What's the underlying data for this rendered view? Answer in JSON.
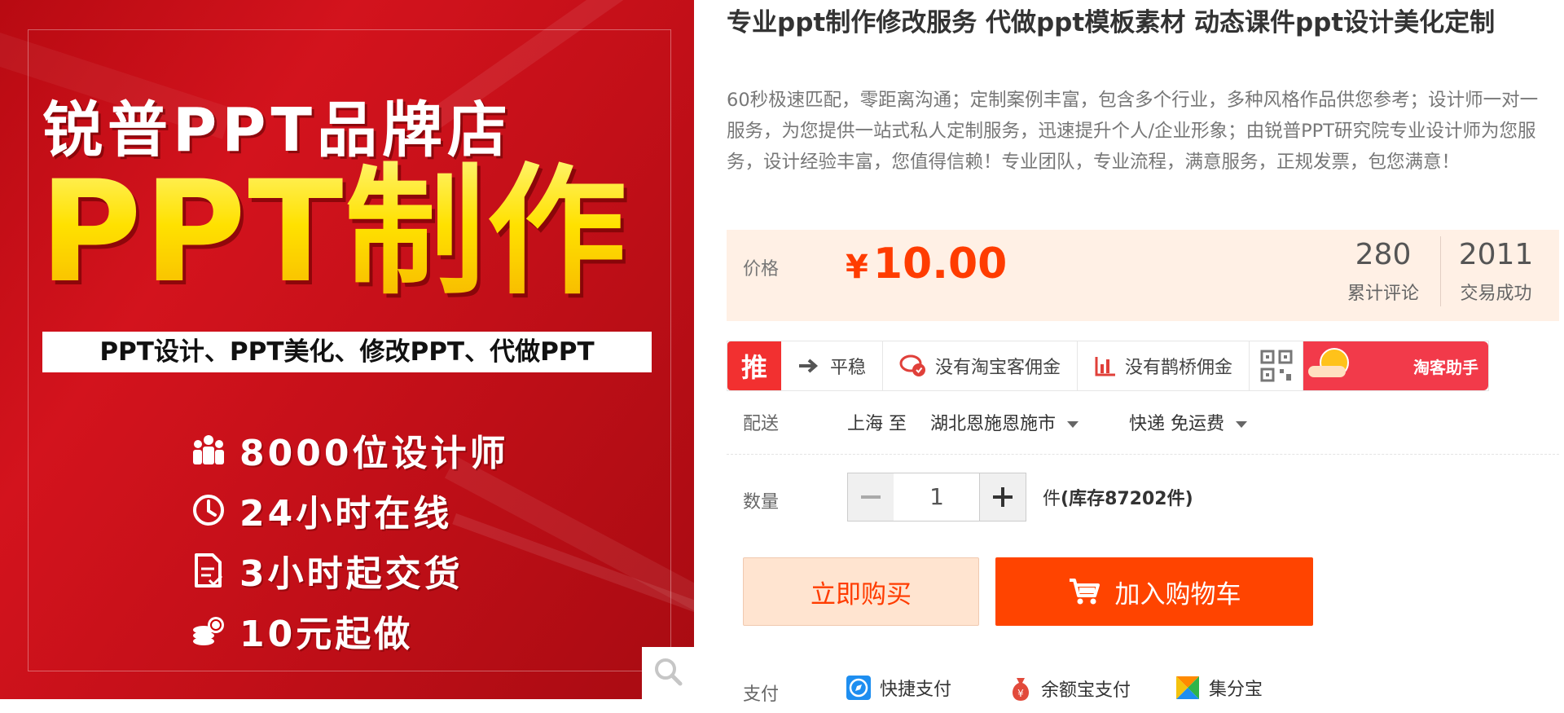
{
  "image": {
    "brand_title": "锐普PPT品牌店",
    "headline": "PPT制作",
    "services": "PPT设计、PPT美化、修改PPT、代做PPT",
    "features": [
      {
        "icon": "people-icon",
        "text": "8000位设计师"
      },
      {
        "icon": "clock-icon",
        "text": "24小时在线"
      },
      {
        "icon": "document-icon",
        "text": "3小时起交货"
      },
      {
        "icon": "coins-icon",
        "text": "10元起做"
      }
    ],
    "zoom_icon": "magnifier-icon"
  },
  "product": {
    "title": "专业ppt制作修改服务 代做ppt模板素材 动态课件ppt设计美化定制",
    "description": "60秒极速匹配，零距离沟通；定制案例丰富，包含多个行业，多种风格作品供您参考；设计师一对一服务，为您提供一站式私人定制服务，迅速提升个人/企业形象；由锐普PPT研究院专业设计师为您服务，设计经验丰富，您值得信赖！专业团队，专业流程，满意服务，正规发票，包您满意！"
  },
  "price": {
    "label": "价格",
    "currency": "¥",
    "value": "10.00",
    "reviews_count": "280",
    "reviews_label": "累计评论",
    "deals_count": "2011",
    "deals_label": "交易成功"
  },
  "promo": {
    "tag": "推",
    "items": [
      {
        "icon": "arrow-right-icon",
        "label": "平稳"
      },
      {
        "icon": "coin-badge-icon",
        "label": "没有淘宝客佣金"
      },
      {
        "icon": "bar-chart-icon",
        "label": "没有鹊桥佣金"
      }
    ],
    "assistant": "淘客助手"
  },
  "delivery": {
    "label": "配送",
    "from": "上海 至",
    "to": "湖北恩施恩施市",
    "shipping": "快递 免运费"
  },
  "quantity": {
    "label": "数量",
    "value": "1",
    "unit": "件",
    "stock": "(库存87202件)"
  },
  "actions": {
    "buy_now": "立即购买",
    "add_to_cart": "加入购物车"
  },
  "payment": {
    "label": "支付",
    "methods": [
      {
        "icon": "compass-icon",
        "label": "快捷支付"
      },
      {
        "icon": "money-bag-icon",
        "label": "余额宝支付"
      },
      {
        "icon": "colorful-square-icon",
        "label": "集分宝"
      }
    ]
  },
  "colors": {
    "accent": "#ff4400",
    "price": "#ff3c00",
    "promo_red": "#f23030",
    "image_red": "#d3131d",
    "headline_yellow": "#ffe400"
  }
}
